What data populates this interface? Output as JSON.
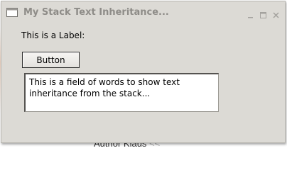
{
  "window": {
    "title": "My Stack Text Inheritance...",
    "icon": "window-icon",
    "controls": [
      "minimize-icon",
      "maximize-icon",
      "close-icon"
    ]
  },
  "content": {
    "label_text": "This is a Label:",
    "button_label": "Button",
    "field_text": "This is a field of words to show text inheritance from the stack..."
  },
  "backdrop": {
    "partial_text": "Author Klaus",
    "partial_suffix": "<<"
  },
  "colors": {
    "window_bg": "#dcdad5",
    "title_text": "#8e8c88",
    "field_bg": "#ffffff"
  }
}
